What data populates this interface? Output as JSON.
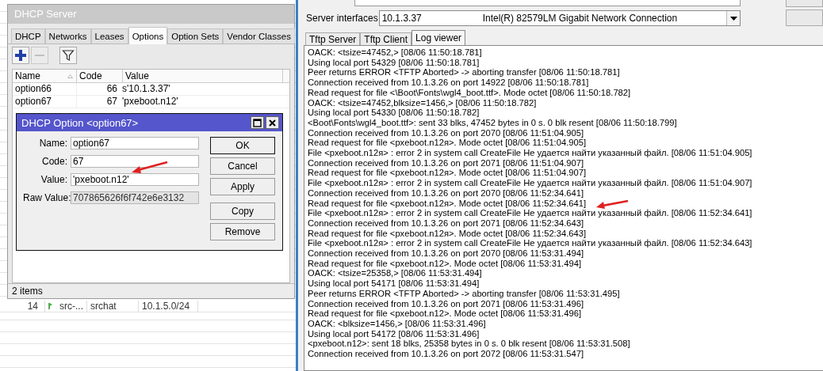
{
  "background_table": {
    "row": {
      "cells": [
        "14",
        "src-...",
        "srchat",
        "10.1.5.0/24"
      ]
    }
  },
  "dhcp_server": {
    "title": "DHCP Server",
    "tabs": [
      {
        "label": "DHCP",
        "selected": false
      },
      {
        "label": "Networks",
        "selected": false
      },
      {
        "label": "Leases",
        "selected": false
      },
      {
        "label": "Options",
        "selected": true
      },
      {
        "label": "Option Sets",
        "selected": false
      },
      {
        "label": "Vendor Classes",
        "selected": false
      }
    ],
    "toolbar": [
      {
        "kind": "add",
        "disabled": false
      },
      {
        "kind": "remove",
        "disabled": true
      },
      {
        "kind": "filter",
        "disabled": false
      }
    ],
    "table": {
      "columns": [
        {
          "label": "Name",
          "sorted": true
        },
        {
          "label": "Code",
          "sorted": false
        },
        {
          "label": "Value",
          "sorted": false
        }
      ],
      "rows": [
        [
          "option66",
          "66",
          "s'10.1.3.37'"
        ],
        [
          "option67",
          "67",
          "'pxeboot.n12'"
        ]
      ]
    },
    "status_bar": "2 items"
  },
  "dialog": {
    "title": "DHCP Option <option67>",
    "fields": [
      {
        "label": "Name:",
        "value": "option67",
        "disabled": false
      },
      {
        "label": "Code:",
        "value": "67",
        "disabled": false
      },
      {
        "label": "Value:",
        "value": "'pxeboot.n12'",
        "disabled": false
      },
      {
        "label": "Raw Value:",
        "value": "707865626f6f742e6e3132",
        "disabled": true
      }
    ],
    "buttons": [
      {
        "label": "OK",
        "default": true
      },
      {
        "label": "Cancel",
        "default": false
      },
      {
        "label": "Apply",
        "default": false
      },
      {
        "label": "Copy",
        "default": false
      },
      {
        "label": "Remove",
        "default": false
      }
    ]
  },
  "tftpd": {
    "server_interfaces": {
      "label": "Server interfaces",
      "address": "10.1.3.37",
      "adapter": "Intel(R) 82579LM Gigabit Network Connection"
    },
    "tabs": [
      {
        "label": "Tftp Server",
        "selected": false
      },
      {
        "label": "Tftp Client",
        "selected": false
      },
      {
        "label": "Log viewer",
        "selected": true
      }
    ],
    "log": [
      "OACK: <tsize=47452,> [08/06 11:50:18.781]",
      "Using local port 54329 [08/06 11:50:18.781]",
      "Peer returns ERROR <TFTP Aborted> -> aborting transfer [08/06 11:50:18.781]",
      "Connection received from 10.1.3.26 on port 14922 [08/06 11:50:18.781]",
      "Read request for file <\\Boot\\Fonts\\wgl4_boot.ttf>. Mode octet [08/06 11:50:18.782]",
      "OACK: <tsize=47452,blksize=1456,> [08/06 11:50:18.782]",
      "Using local port 54330 [08/06 11:50:18.782]",
      "<Boot\\Fonts\\wgl4_boot.ttf>: sent 33 blks, 47452 bytes in 0 s. 0 blk resent [08/06 11:50:18.799]",
      "Connection received from 10.1.3.26 on port 2070 [08/06 11:51:04.905]",
      "Read request for file <pxeboot.n12я>. Mode octet [08/06 11:51:04.905]",
      "File <pxeboot.n12я> : error 2 in system call CreateFile Не удается найти указанный файл. [08/06 11:51:04.905]",
      "Connection received from 10.1.3.26 on port 2071 [08/06 11:51:04.907]",
      "Read request for file <pxeboot.n12я>. Mode octet [08/06 11:51:04.907]",
      "File <pxeboot.n12я> : error 2 in system call CreateFile Не удается найти указанный файл. [08/06 11:51:04.907]",
      "Connection received from 10.1.3.26 on port 2070 [08/06 11:52:34.641]",
      "Read request for file <pxeboot.n12я>. Mode octet [08/06 11:52:34.641]",
      "File <pxeboot.n12я> : error 2 in system call CreateFile Не удается найти указанный файл. [08/06 11:52:34.641]",
      "Connection received from 10.1.3.26 on port 2071 [08/06 11:52:34.643]",
      "Read request for file <pxeboot.n12я>. Mode octet [08/06 11:52:34.643]",
      "File <pxeboot.n12я> : error 2 in system call CreateFile Не удается найти указанный файл. [08/06 11:52:34.643]",
      "Connection received from 10.1.3.26 on port 2070 [08/06 11:53:31.494]",
      "Read request for file <pxeboot.n12>. Mode octet [08/06 11:53:31.494]",
      "OACK: <tsize=25358,> [08/06 11:53:31.494]",
      "Using local port 54171 [08/06 11:53:31.494]",
      "Peer returns ERROR <TFTP Aborted> -> aborting transfer [08/06 11:53:31.495]",
      "Connection received from 10.1.3.26 on port 2071 [08/06 11:53:31.496]",
      "Read request for file <pxeboot.n12>. Mode octet [08/06 11:53:31.496]",
      "OACK: <blksize=1456,> [08/06 11:53:31.496]",
      "Using local port 54172 [08/06 11:53:31.496]",
      "<pxeboot.n12>: sent 18 blks, 25358 bytes in 0 s. 0 blk resent [08/06 11:53:31.508]",
      "Connection received from 10.1.3.26 on port 2072 [08/06 11:53:31.547]"
    ]
  }
}
